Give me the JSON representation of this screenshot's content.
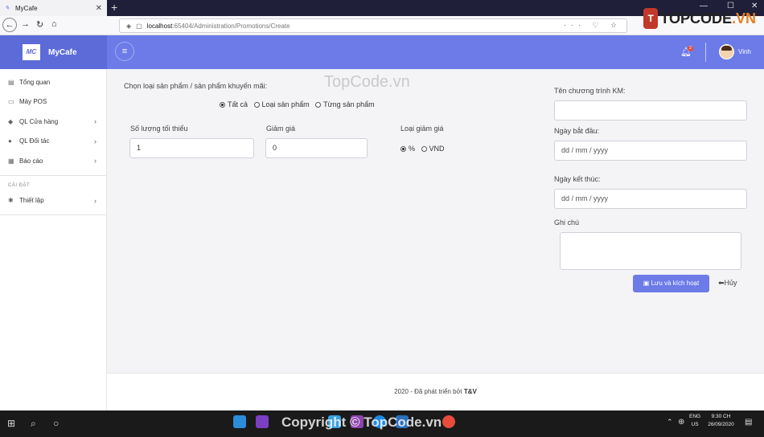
{
  "browser": {
    "tab_title": "MyCafe",
    "tab_close": "✕",
    "new_tab": "+",
    "url_host": "localhost",
    "url_path": ":65404/Administration/Promotions/Create",
    "url_actions": "··· ♡ ☆",
    "window_controls": {
      "minimize": "—",
      "maximize": "☐",
      "close": "✕"
    }
  },
  "watermarks": {
    "logo_badge": "T",
    "logo_text": "TOPCODE",
    "logo_suffix": ".VN",
    "center": "TopCode.vn",
    "copyright": "Copyright © TopCode.vn"
  },
  "app": {
    "logo_text": "MC",
    "brand": "MyCafe",
    "notification_count": "2",
    "user_name": "Vinh"
  },
  "sidebar": {
    "items": [
      {
        "label": "Tổng quan",
        "icon": "chart-icon",
        "glyph": "▤",
        "chevron": false
      },
      {
        "label": "Máy POS",
        "icon": "monitor-icon",
        "glyph": "▭",
        "chevron": false
      },
      {
        "label": "QL Cửa hàng",
        "icon": "store-icon",
        "glyph": "◆",
        "chevron": true
      },
      {
        "label": "QL Đối tác",
        "icon": "users-icon",
        "glyph": "●",
        "chevron": true
      },
      {
        "label": "Báo cáo",
        "icon": "table-icon",
        "glyph": "▦",
        "chevron": true
      }
    ],
    "section_label": "CÀI ĐẶT",
    "settings_item": {
      "label": "Thiết lập",
      "icon": "gear-icon",
      "glyph": "✱",
      "chevron": true
    }
  },
  "form": {
    "product_select_label": "Chọn loại sản phẩm / sản phẩm khuyến mãi:",
    "scope_options": [
      {
        "label": "Tất cả",
        "checked": true
      },
      {
        "label": "Loại sản phẩm",
        "checked": false
      },
      {
        "label": "Từng sản phẩm",
        "checked": false
      }
    ],
    "min_qty_label": "Số lượng tối thiểu",
    "min_qty_value": "1",
    "discount_label": "Giảm giá",
    "discount_value": "0",
    "discount_type_label": "Loại giảm giá",
    "discount_type_options": [
      {
        "label": "%",
        "checked": true
      },
      {
        "label": "VND",
        "checked": false
      }
    ],
    "program_name_label": "Tên chương trình KM:",
    "program_name_value": "",
    "start_date_label": "Ngày bắt đầu:",
    "start_date_placeholder": "dd / mm / yyyy",
    "end_date_label": "Ngày kết thúc:",
    "end_date_placeholder": "dd / mm / yyyy",
    "note_label": "Ghi chú",
    "save_button": "Lưu và kích hoạt",
    "cancel_button": "Hủy"
  },
  "footer": {
    "text": "2020 - Đã phát triển bởi",
    "author": "T&V"
  },
  "taskbar": {
    "language": "ENG",
    "region": "US",
    "time": "9:30 CH",
    "date": "26/09/2020"
  },
  "colors": {
    "primary": "#6c7be8",
    "brand_dark": "#5c6bd8",
    "background": "#f4f4f7"
  }
}
